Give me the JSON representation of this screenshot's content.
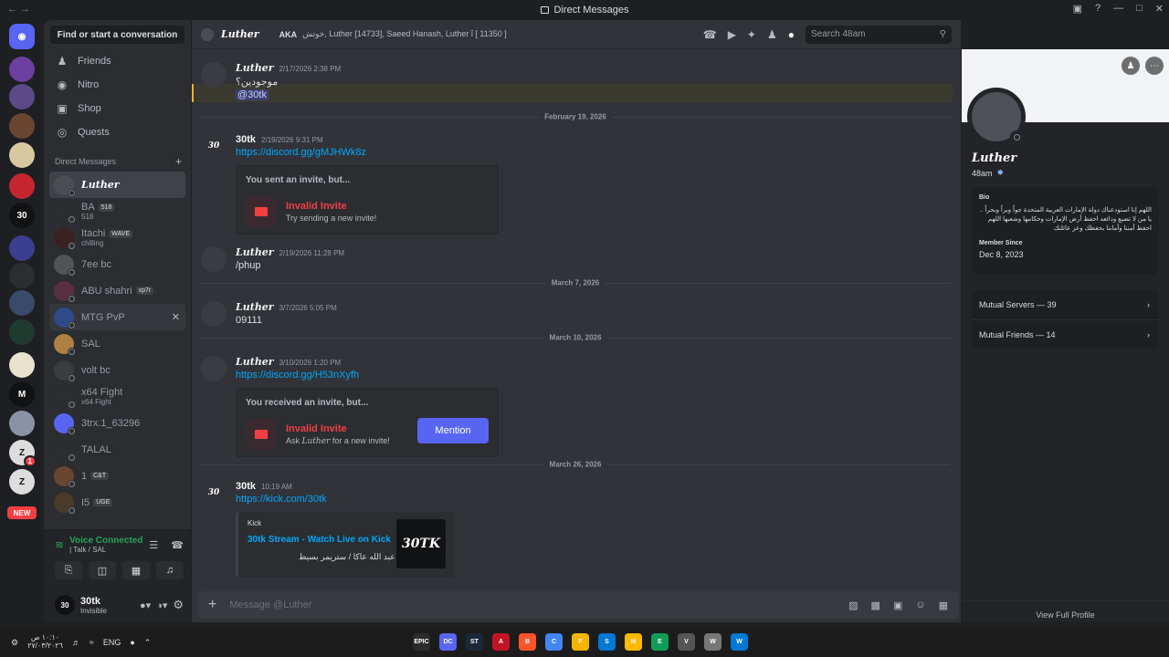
{
  "window": {
    "title": "Direct Messages"
  },
  "titlebar": {
    "back": "← →"
  },
  "servers": [
    {
      "color": "#5865f2",
      "label": ""
    },
    {
      "color": "#6b3fa0",
      "label": ""
    },
    {
      "color": "#5b4a8a",
      "label": ""
    },
    {
      "color": "#6a4632",
      "label": ""
    },
    {
      "color": "#d9c7a0",
      "label": ""
    },
    {
      "color": "#c4262e",
      "label": ""
    },
    {
      "color": "#111214",
      "label": "30"
    },
    {
      "color": "#3b3f8f",
      "label": ""
    },
    {
      "color": "#2b2d31",
      "label": ""
    },
    {
      "color": "#3a4a6a",
      "label": ""
    },
    {
      "color": "#1f3b2f",
      "label": ""
    },
    {
      "color": "#e9e2cf",
      "label": ""
    },
    {
      "color": "#111214",
      "label": "M"
    },
    {
      "color": "#8a93a6",
      "label": ""
    },
    {
      "color": "#ddd",
      "label": "Z",
      "badge": "1"
    },
    {
      "color": "#ddd",
      "label": "Z"
    }
  ],
  "new_badge": "NEW",
  "sidebar": {
    "find": "Find or start a conversation",
    "nav": [
      {
        "label": "Friends",
        "icon": "friends-icon",
        "glyph": "♟"
      },
      {
        "label": "Nitro",
        "icon": "nitro-icon",
        "glyph": "◉"
      },
      {
        "label": "Shop",
        "icon": "shop-icon",
        "glyph": "▣"
      },
      {
        "label": "Quests",
        "icon": "quests-icon",
        "glyph": "◎"
      }
    ],
    "dm_header": "Direct Messages",
    "dm_add": "+",
    "dms": [
      {
        "name": "Luther",
        "sub": "",
        "tag": "",
        "color": "#4a4d54"
      },
      {
        "name": "BA",
        "sub": "518",
        "tag": "518",
        "color": "#2b2d31"
      },
      {
        "name": "Itachi",
        "sub": "chilling",
        "tag": "WAVE",
        "color": "#3a2020"
      },
      {
        "name": "7ee bc",
        "sub": "",
        "tag": "",
        "color": "#505358"
      },
      {
        "name": "ABU shahri",
        "sub": "",
        "tag": "xp7r",
        "color": "#5a3040"
      },
      {
        "name": "MTG PvP",
        "sub": "",
        "tag": "",
        "color": "#2e4a8a"
      },
      {
        "name": "SAL",
        "sub": "",
        "tag": "",
        "color": "#b08040"
      },
      {
        "name": "volt bc",
        "sub": "",
        "tag": "",
        "color": "#3a3c41"
      },
      {
        "name": "x64 Fight",
        "sub": "x64 Fight",
        "tag": "",
        "color": "#2b2d31"
      },
      {
        "name": "3trx.1_63296",
        "sub": "",
        "tag": "",
        "color": "#5865f2"
      },
      {
        "name": "TALAL",
        "sub": "",
        "tag": "",
        "color": "#2b2d31"
      },
      {
        "name": "1",
        "sub": "",
        "tag": "C&T",
        "color": "#6a4632"
      },
      {
        "name": "I5",
        "sub": "",
        "tag": "UGE",
        "color": "#4a3a2a"
      }
    ]
  },
  "voice": {
    "status": "Voice Connected",
    "channel": "| Talk / SAL"
  },
  "user": {
    "name": "30tk",
    "status": "Invisible"
  },
  "chat": {
    "name": "Luther",
    "aka_label": "AKA",
    "aka_names": "خوتش, Luther [14733], Saeed Hanash, Luther ἲ [ 11350 ]",
    "search_placeholder": "Search 48am",
    "composer_placeholder": "Message @Luther",
    "messages": {
      "m0": {
        "author": "Luther",
        "time": "2/17/2026 2:38 PM",
        "text": "موجودين؟",
        "mention": "@30tk"
      },
      "d1": "February 19, 2026",
      "m1": {
        "author": "30tk",
        "time": "2/19/2026 9:31 PM",
        "link": "https://discord.gg/gMJHWk8z"
      },
      "inv1": {
        "title": "You sent an invite, but...",
        "bad": "Invalid Invite",
        "sub": "Try sending a new invite!"
      },
      "m2": {
        "author": "Luther",
        "time": "2/19/2026 11:28 PM",
        "text": "/phup"
      },
      "d2": "March 7, 2026",
      "m3": {
        "author": "Luther",
        "time": "3/7/2026 5:05 PM",
        "text": "09111"
      },
      "d3": "March 10, 2026",
      "m4": {
        "author": "Luther",
        "time": "3/10/2026 1:20 PM",
        "link": "https://discord.gg/H53nXyfh"
      },
      "inv2": {
        "title": "You received an invite, but...",
        "bad": "Invalid Invite",
        "sub_pre": "Ask",
        "sub_name": "Luther",
        "sub_post": "for a new invite!",
        "button": "Mention"
      },
      "d4": "March 26, 2026",
      "m5": {
        "author": "30tk",
        "time": "10:19 AM",
        "link": "https://kick.com/30tk"
      },
      "embed": {
        "provider": "Kick",
        "title": "30tk Stream - Watch Live on Kick",
        "desc": "اسمي عبد الله عاكا / ستريمر بسيط",
        "thumb": "30TK"
      }
    }
  },
  "profile": {
    "name": "Luther",
    "username": "48am",
    "bio_label": "Bio",
    "bio": "اللهم إنا استودعناك دولة الإمارات العربية المتحدة جواً وبراً وبحراً .. يا من لا تضيع ودائعه احفظ أرض الإمارات وحكامها وشعبها اللهم احفظ أمننا وأماننا بحفظك وعز عائلتك",
    "since_label": "Member Since",
    "since": "Dec 8, 2023",
    "mutual_servers": "Mutual Servers — 39",
    "mutual_friends": "Mutual Friends — 14",
    "view_full": "View Full Profile"
  },
  "taskbar": {
    "lang": "ENG",
    "clock_time": "١٠:١٠ ص",
    "clock_date": "٢٧/٠٣/٢٠٢٦",
    "apps": [
      "EPIC",
      "DC",
      "ST",
      "A",
      "B",
      "C",
      "F",
      "S",
      "M",
      "E",
      "V",
      "W",
      "W"
    ]
  }
}
